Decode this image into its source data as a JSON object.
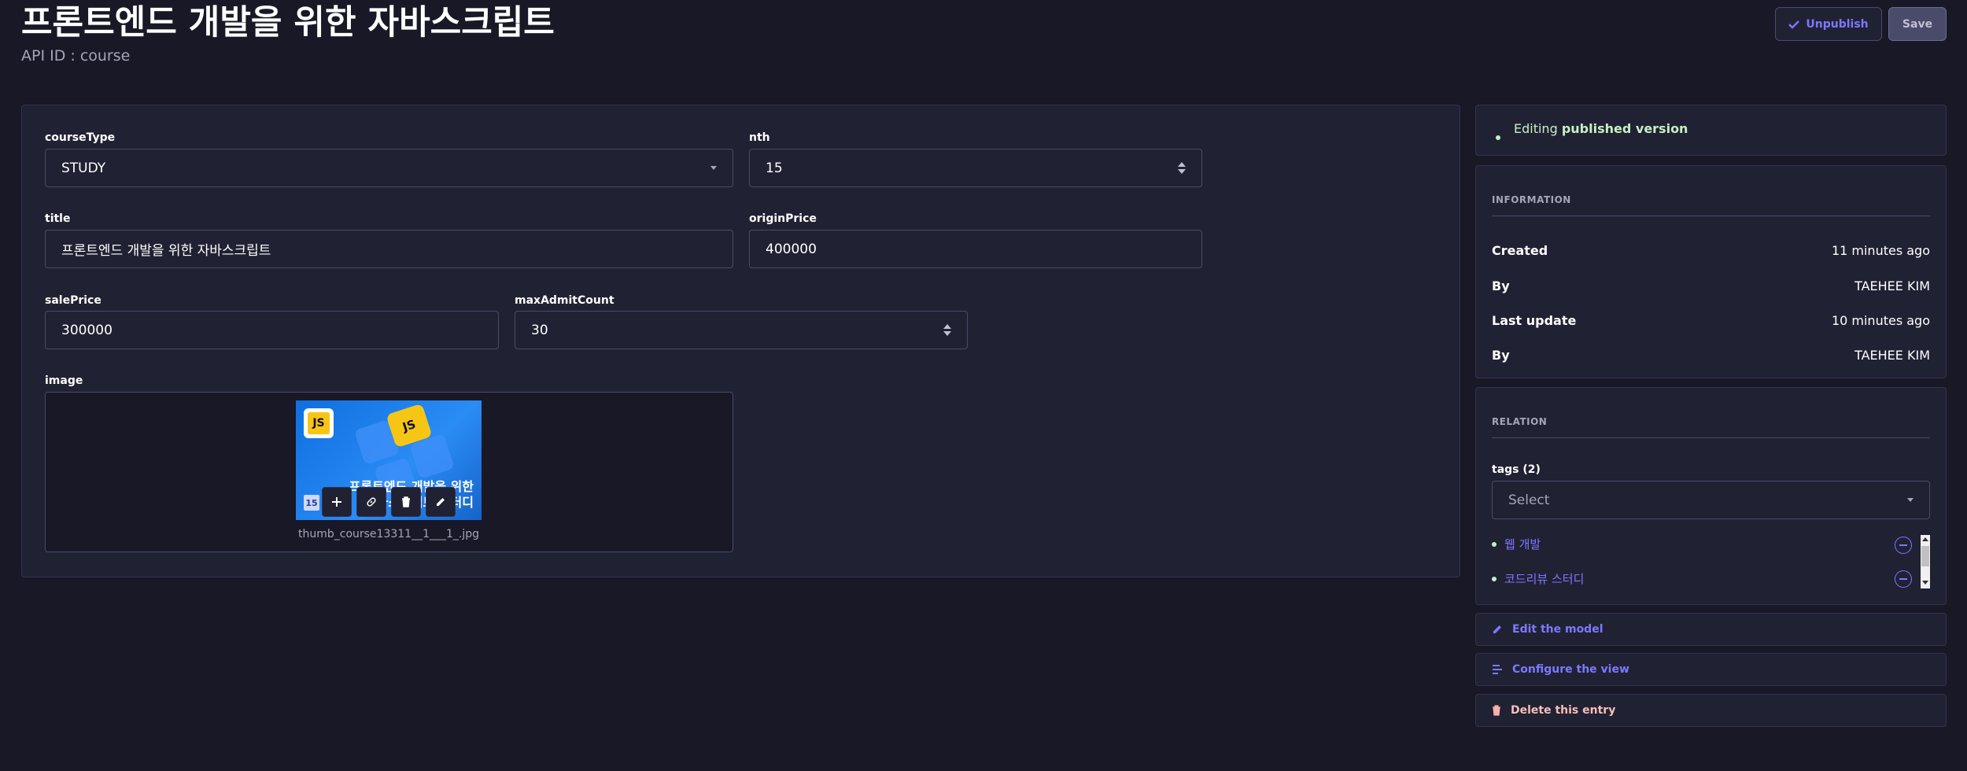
{
  "header": {
    "title": "프론트엔드 개발을 위한 자바스크립트",
    "api_id": "API ID : course",
    "unpublish_label": "Unpublish",
    "save_label": "Save"
  },
  "form": {
    "courseType": {
      "label": "courseType",
      "value": "STUDY"
    },
    "nth": {
      "label": "nth",
      "value": "15"
    },
    "title": {
      "label": "title",
      "value": "프론트엔드 개발을 위한 자바스크립트"
    },
    "originPrice": {
      "label": "originPrice",
      "value": "400000"
    },
    "salePrice": {
      "label": "salePrice",
      "value": "300000"
    },
    "maxAdmitCount": {
      "label": "maxAdmitCount",
      "value": "30"
    },
    "image": {
      "label": "image",
      "filename": "thumb_course13311__1___1_.jpg",
      "thumb_logo": "JS",
      "thumb_key": "JS",
      "thumb_line1": "프론트엔드 개발을 위한",
      "thumb_line2": "자바스크립트 스터디",
      "thumb_badge": "15"
    },
    "image_tools": [
      "add-icon",
      "link-icon",
      "trash-icon",
      "pencil-icon"
    ]
  },
  "sidebar": {
    "status": {
      "prefix": "Editing",
      "strong": "published version"
    },
    "information": {
      "title": "INFORMATION",
      "rows": [
        {
          "key": "Created",
          "value": "11 minutes ago"
        },
        {
          "key": "By",
          "value": "TAEHEE KIM"
        },
        {
          "key": "Last update",
          "value": "10 minutes ago"
        },
        {
          "key": "By",
          "value": "TAEHEE KIM"
        }
      ]
    },
    "relation": {
      "title": "RELATION",
      "tags_label": "tags (2)",
      "select_placeholder": "Select",
      "tags": [
        "웹 개발",
        "코드리뷰 스터디"
      ]
    },
    "actions": {
      "edit_model": "Edit the model",
      "configure_view": "Configure the view",
      "delete_entry": "Delete this entry"
    }
  },
  "colors": {
    "background": "#181826",
    "panel": "#212134",
    "accent": "#7b79ff",
    "success": "#c6f0c2",
    "danger": "#f5c0b8"
  }
}
